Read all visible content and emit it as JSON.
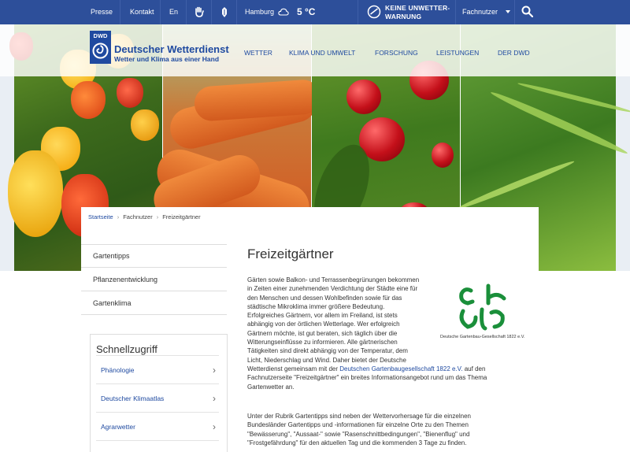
{
  "topbar": {
    "presse": "Presse",
    "kontakt": "Kontakt",
    "lang": "En",
    "city": "Hamburg",
    "temperature": "5 °C",
    "warning_line1": "KEINE UNWETTER-",
    "warning_line2": "WARNUNG",
    "user_type": "Fachnutzer"
  },
  "logo": {
    "badge": "DWD",
    "title": "Deutscher Wetterdienst",
    "subtitle": "Wetter und Klima aus einer Hand"
  },
  "mainnav": {
    "wetter": "WETTER",
    "klima": "KLIMA UND UMWELT",
    "forschung": "FORSCHUNG",
    "leistungen": "LEISTUNGEN",
    "der_dwd": "DER DWD"
  },
  "breadcrumb": {
    "home": "Startseite",
    "level1": "Fachnutzer",
    "current": "Freizeitgärtner"
  },
  "sidebar": {
    "items": [
      {
        "label": "Gartentipps"
      },
      {
        "label": "Pflanzenentwicklung"
      },
      {
        "label": "Gartenklima"
      }
    ]
  },
  "quick": {
    "title": "Schnellzugriff",
    "items": [
      {
        "label": "Phänologie"
      },
      {
        "label": "Deutscher Klimaatlas"
      },
      {
        "label": "Agrarwetter"
      }
    ]
  },
  "article": {
    "title": "Freizeitgärtner",
    "p1_lines": [
      "Gärten sowie Balkon- und Terrassenbegrünungen bekommen",
      "in Zeiten einer zunehmenden Verdichtung der Städte eine für",
      "den Menschen und dessen Wohlbefinden sowie für das",
      "städtische Mikroklima immer größere Bedeutung.",
      "Erfolgreiches Gärtnern, vor allem im Freiland, ist stets",
      "abhängig von der örtlichen Wetterlage. Wer erfolgreich",
      "Gärtnern möchte, ist gut beraten, sich täglich über die",
      "Witterungseinflüsse zu informieren. Alle gärtnerischen",
      "Tätigkeiten sind direkt abhängig von der Temperatur, dem",
      "Licht, Niederschlag und Wind. Daher bietet der Deutsche"
    ],
    "p1_line11_pre": "Wetterdienst gemeinsam mit der ",
    "p1_link": "Deutschen Gartenbaugesellschaft 1822 e.V.",
    "p1_line11_post": " auf den",
    "p1_line12": "Fachnutzerseite \"Freizeitgärtner\" ein breites Informationsangebot rund um das Thema",
    "p1_line13": "Gartenwetter an.",
    "p2_lines": [
      "Unter der Rubrik Gartentipps sind neben der Wettervorhersage für die einzelnen",
      "Bundesländer Gartentipps und -informationen für einzelne Orte zu den Themen",
      "\"Bewässerung\", \"Aussaat-\" sowie \"Rasenschnittbedingungen\", \"Bienenflug\" und",
      "\"Frostgefährdung\" für den aktuellen Tag und die kommenden 3 Tage zu finden."
    ],
    "partner_caption": "Deutsche Gartenbau-Gesellschaft 1822 e.V."
  },
  "colors": {
    "brand_blue": "#2d4f9a",
    "link_blue": "#1f4aa0"
  }
}
